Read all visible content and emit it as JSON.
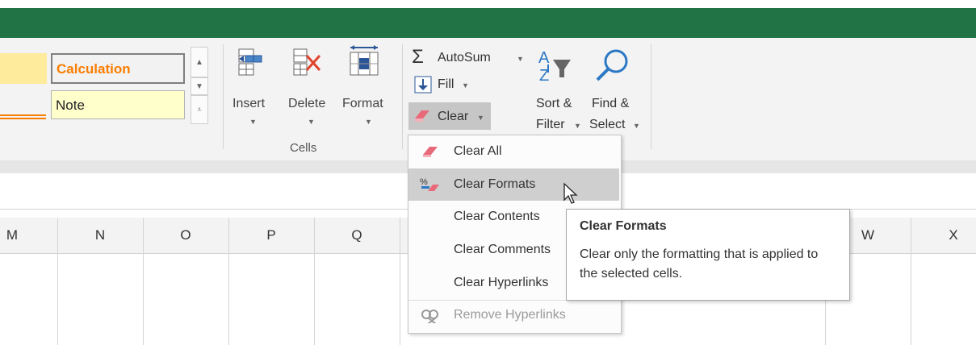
{
  "styles": {
    "calculation": "Calculation",
    "note": "Note"
  },
  "cells_group": {
    "insert": "Insert",
    "delete": "Delete",
    "format": "Format",
    "label": "Cells"
  },
  "editing": {
    "autosum": "AutoSum",
    "fill": "Fill",
    "clear": "Clear",
    "sort_line1": "Sort &",
    "sort_line2": "Filter",
    "find_line1": "Find &",
    "find_line2": "Select"
  },
  "columns": [
    "M",
    "N",
    "O",
    "P",
    "Q",
    "W",
    "X"
  ],
  "clear_menu": {
    "items": [
      {
        "label": "Clear All",
        "icon": "eraser-icon"
      },
      {
        "label": "Clear Formats",
        "icon": "clear-formats-icon",
        "highlighted": true
      },
      {
        "label": "Clear Contents"
      },
      {
        "label": "Clear Comments"
      },
      {
        "label": "Clear Hyperlinks"
      },
      {
        "label": "Remove Hyperlinks",
        "icon": "remove-hyperlinks-icon",
        "disabled": true
      }
    ]
  },
  "tooltip": {
    "title": "Clear Formats",
    "body": "Clear only the formatting that is applied to the selected cells."
  },
  "colors": {
    "title_bar": "#217346",
    "calculation_text": "#fa7d00",
    "highlight": "#cfcfcf",
    "note_fill": "#ffffcc",
    "neutral_fill": "#ffeb9c"
  }
}
